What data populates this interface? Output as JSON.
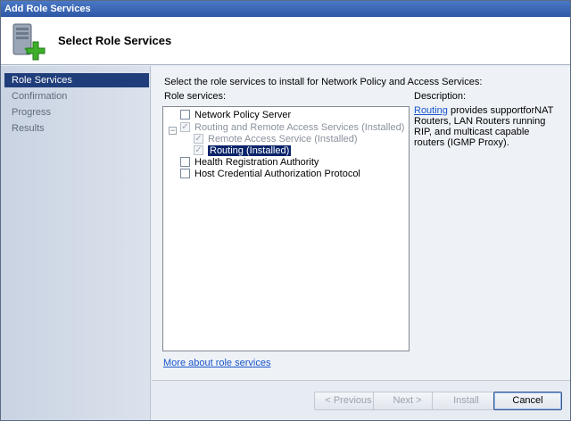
{
  "window": {
    "title": "Add Role Services"
  },
  "header": {
    "title": "Select Role Services",
    "icon": "server-add-icon"
  },
  "nav": {
    "items": [
      {
        "label": "Role Services",
        "active": true
      },
      {
        "label": "Confirmation",
        "active": false
      },
      {
        "label": "Progress",
        "active": false
      },
      {
        "label": "Results",
        "active": false
      }
    ]
  },
  "content": {
    "instruction": "Select the role services to install for Network Policy and Access Services:",
    "role_services_label": "Role services:",
    "description_label": "Description:",
    "tree": [
      {
        "label": "Network Policy Server",
        "checked": false,
        "enabled": true
      },
      {
        "label": "Routing and Remote Access Services  (Installed)",
        "checked": true,
        "enabled": false
      },
      {
        "label": "Remote Access Service  (Installed)",
        "checked": true,
        "enabled": false
      },
      {
        "label": "Routing  (Installed)",
        "checked": true,
        "enabled": false,
        "selected": true
      },
      {
        "label": "Health Registration Authority",
        "checked": false,
        "enabled": true
      },
      {
        "label": "Host Credential Authorization Protocol",
        "checked": false,
        "enabled": true
      }
    ],
    "expander_symbol": "−",
    "description_link": "Routing",
    "description_text": " provides supportforNAT Routers, LAN Routers running RIP, and multicast capable routers (IGMP Proxy).",
    "more_link": "More about role services"
  },
  "buttons": {
    "previous": "< Previous",
    "next": "Next >",
    "install": "Install",
    "cancel": "Cancel"
  },
  "colors": {
    "accent": "#1f3d7a",
    "link": "#1a55c8"
  }
}
